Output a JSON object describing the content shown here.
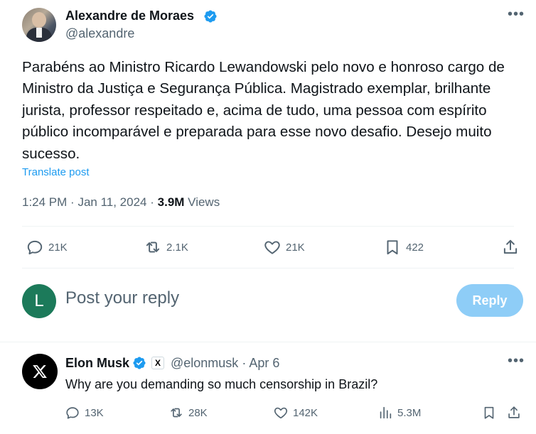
{
  "post": {
    "author_name": "Alexandre de Moraes",
    "author_handle": "@alexandre",
    "text": "Parabéns ao Ministro Ricardo Lewandowski pelo novo e honroso cargo de Ministro da Justiça e Segurança Pública. Magistrado exemplar, brilhante jurista, professor respeitado e, acima de tudo, uma pessoa com espírito público incomparável e preparada para esse novo desafio. Desejo muito sucesso.",
    "translate_label": "Translate post",
    "time": "1:24 PM",
    "separator": "·",
    "date": "Jan 11, 2024",
    "views_count": "3.9M",
    "views_label": "Views",
    "actions": {
      "replies": "21K",
      "reposts": "2.1K",
      "likes": "21K",
      "bookmarks": "422"
    }
  },
  "composer": {
    "avatar_letter": "L",
    "placeholder": "Post your reply",
    "reply_button": "Reply"
  },
  "reply": {
    "author_name": "Elon Musk",
    "badge_glyph": "X",
    "author_handle": "@elonmusk",
    "separator": "·",
    "date": "Apr 6",
    "text": "Why are you demanding so much censorship in Brazil?",
    "actions": {
      "replies": "13K",
      "reposts": "28K",
      "likes": "142K",
      "views": "5.3M"
    }
  },
  "colors": {
    "accent": "#1d9bf0",
    "reply_button_disabled": "#8ecdf7",
    "secondary_text": "#536471",
    "composer_avatar": "#1c7a5a"
  }
}
